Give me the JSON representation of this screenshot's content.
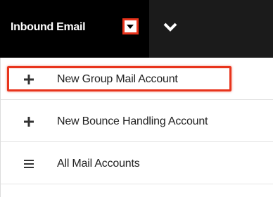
{
  "navbar": {
    "module_title": "Inbound Email",
    "caret_icon": "caret-down-icon",
    "more_icon": "chevron-down-icon",
    "accent_color": "#e8341c"
  },
  "menu": {
    "items": [
      {
        "label": "New Group Mail Account",
        "icon": "plus-icon"
      },
      {
        "label": "New Bounce Handling Account",
        "icon": "plus-icon"
      },
      {
        "label": "All Mail Accounts",
        "icon": "list-icon"
      }
    ]
  }
}
